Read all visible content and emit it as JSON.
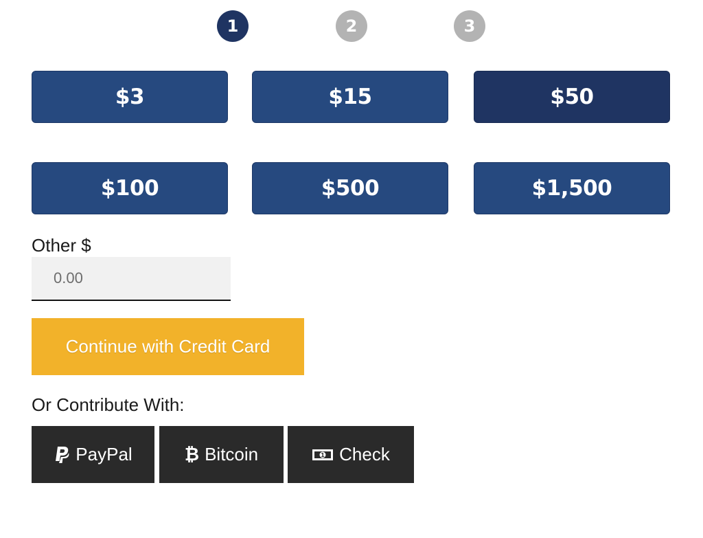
{
  "steps": [
    {
      "label": "1",
      "state": "active"
    },
    {
      "label": "2",
      "state": "inactive"
    },
    {
      "label": "3",
      "state": "inactive"
    }
  ],
  "amounts": [
    {
      "label": "$3",
      "selected": false
    },
    {
      "label": "$15",
      "selected": false
    },
    {
      "label": "$50",
      "selected": true
    },
    {
      "label": "$100",
      "selected": false
    },
    {
      "label": "$500",
      "selected": false
    },
    {
      "label": "$1,500",
      "selected": false
    }
  ],
  "other": {
    "label": "Other $",
    "placeholder": "0.00"
  },
  "continue_label": "Continue with Credit Card",
  "contribute": {
    "label": "Or Contribute With:",
    "options": [
      {
        "label": "PayPal",
        "icon": "paypal-icon"
      },
      {
        "label": "Bitcoin",
        "icon": "bitcoin-icon"
      },
      {
        "label": "Check",
        "icon": "check-icon"
      }
    ]
  },
  "colors": {
    "step_active": "#1f3462",
    "step_inactive": "#b3b3b3",
    "amount_button": "#26497f",
    "amount_selected": "#1f3462",
    "continue_button": "#f2b22a",
    "payment_button": "#2a2a2a"
  }
}
